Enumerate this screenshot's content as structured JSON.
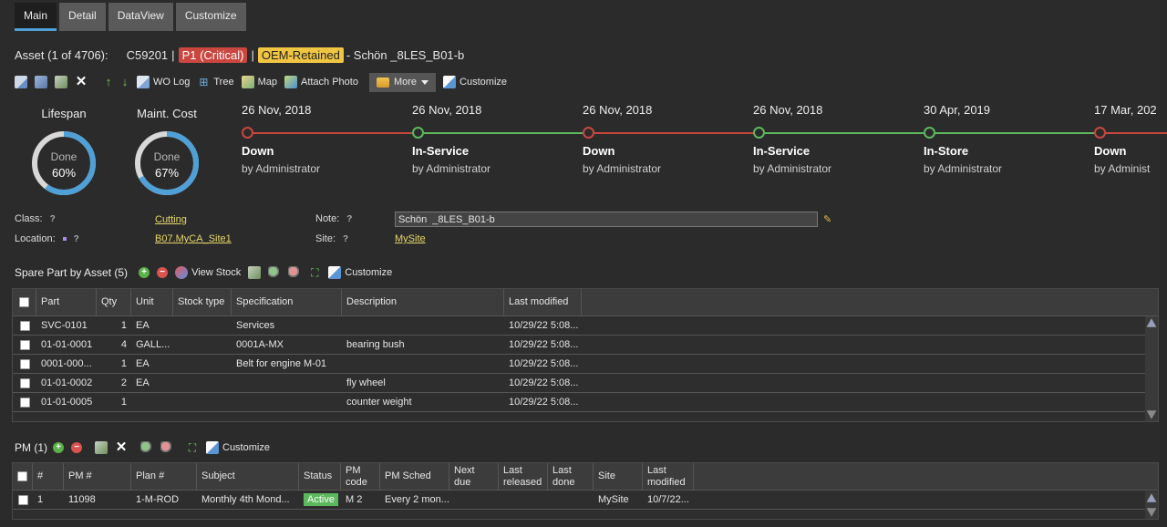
{
  "tabs": [
    {
      "label": "Main",
      "active": true
    },
    {
      "label": "Detail",
      "active": false
    },
    {
      "label": "DataView",
      "active": false
    },
    {
      "label": "Customize",
      "active": false
    }
  ],
  "asset": {
    "prefix": "Asset (1 of 4706):",
    "code": "C59201",
    "sep1": "|",
    "priority": "P1 (Critical)",
    "sep2": "|",
    "status": "OEM-Retained",
    "name": "- Schön _8LES_B01-b"
  },
  "toolbar": {
    "wo_log": "WO Log",
    "tree": "Tree",
    "map": "Map",
    "attach_photo": "Attach Photo",
    "more": "More",
    "customize": "Customize"
  },
  "gauges": [
    {
      "title": "Lifespan",
      "done": "Done",
      "pct_label": "60%",
      "pct": 60
    },
    {
      "title": "Maint. Cost",
      "done": "Done",
      "pct_label": "67%",
      "pct": 67
    }
  ],
  "timeline": [
    {
      "date": "26 Nov, 2018",
      "status": "Down",
      "by": "by Administrator",
      "color": "#c9473f"
    },
    {
      "date": "26 Nov, 2018",
      "status": "In-Service",
      "by": "by Administrator",
      "color": "#5cb85c"
    },
    {
      "date": "26 Nov, 2018",
      "status": "Down",
      "by": "by Administrator",
      "color": "#c9473f"
    },
    {
      "date": "26 Nov, 2018",
      "status": "In-Service",
      "by": "by Administrator",
      "color": "#5cb85c"
    },
    {
      "date": "30 Apr, 2019",
      "status": "In-Store",
      "by": "by Administrator",
      "color": "#5cb85c"
    },
    {
      "date": "17 Mar, 202",
      "status": "Down",
      "by": "by Administ",
      "color": "#c9473f"
    }
  ],
  "fields": {
    "class_label": "Class:",
    "class_value": "Cutting",
    "location_label": "Location:",
    "location_value": "B07.MyCA_Site1",
    "note_label": "Note:",
    "note_value": "Schön  _8LES_B01-b",
    "site_label": "Site:",
    "site_value": "MySite",
    "help": "?"
  },
  "spare": {
    "title": "Spare Part by Asset (5)",
    "view_stock": "View Stock",
    "customize": "Customize",
    "headers": [
      "Part",
      "Qty",
      "Unit",
      "Stock type",
      "Specification",
      "Description",
      "Last modified"
    ],
    "rows": [
      [
        "SVC-0101",
        "1",
        "EA",
        "",
        "Services",
        "",
        "10/29/22 5:08..."
      ],
      [
        "01-01-0001",
        "4",
        "GALL...",
        "",
        "0001A-MX",
        "bearing bush",
        "10/29/22 5:08..."
      ],
      [
        "0001-000...",
        "1",
        "EA",
        "",
        "Belt for engine M-01",
        "",
        "10/29/22 5:08..."
      ],
      [
        "01-01-0002",
        "2",
        "EA",
        "",
        "",
        "fly wheel",
        "10/29/22 5:08..."
      ],
      [
        "01-01-0005",
        "1",
        "",
        "",
        "",
        "counter weight",
        "10/29/22 5:08..."
      ]
    ]
  },
  "pm": {
    "title": "PM (1)",
    "customize": "Customize",
    "headers": [
      "#",
      "PM #",
      "Plan #",
      "Subject",
      "Status",
      "PM code",
      "PM Sched",
      "Next due",
      "Last released",
      "Last done",
      "Site",
      "Last modified"
    ],
    "rows": [
      [
        "1",
        "11098",
        "1-M-ROD",
        "Monthly 4th Mond...",
        "Active",
        "M 2",
        "Every 2 mon...",
        "",
        "",
        "",
        "MySite",
        "10/7/22..."
      ]
    ]
  },
  "colors": {
    "accent": "#4fa0d6",
    "ring_track": "#d8d8d8",
    "ring_fill": "#4fa0d6"
  }
}
